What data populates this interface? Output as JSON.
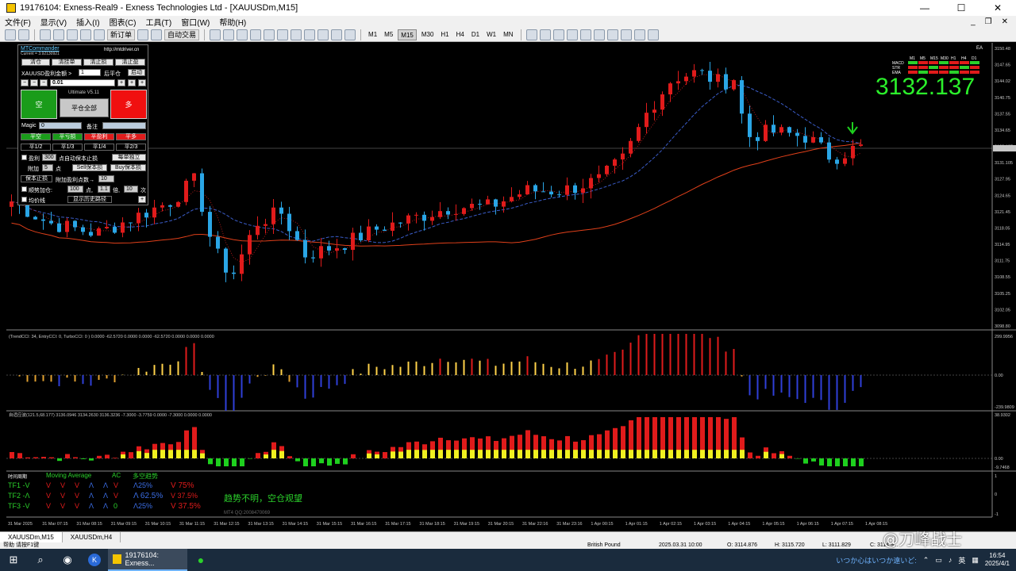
{
  "window": {
    "title": "19176104: Exness-Real9 - Exness Technologies Ltd - [XAUUSDm,M15]",
    "minimize": "—",
    "maximize": "☐",
    "close": "✕"
  },
  "menu": {
    "items": [
      "文件(F)",
      "显示(V)",
      "插入(I)",
      "图表(C)",
      "工具(T)",
      "窗口(W)",
      "帮助(H)"
    ],
    "mdi": [
      "_",
      "❐",
      "✕"
    ]
  },
  "toolbar": {
    "new_order": "新订单",
    "autotrade": "自动交易",
    "timeframes": [
      "M1",
      "M5",
      "M15",
      "M30",
      "H1",
      "H4",
      "D1",
      "W1",
      "MN"
    ],
    "active_timeframe": "M15"
  },
  "price_axis": [
    "3150.48",
    "3147.65",
    "3144.02",
    "3140.75",
    "3137.55",
    "3134.65",
    "3132.137",
    "3131.105",
    "3127.95",
    "3124.65",
    "3121.45",
    "3118.05",
    "3114.95",
    "3111.75",
    "3108.55",
    "3105.25",
    "3102.05",
    "3098.80"
  ],
  "current_price": "3132.137",
  "time_axis": [
    "31 Mar 2025",
    "31 Mar 07:15",
    "31 Mar 08:15",
    "31 Mar 09:15",
    "31 Mar 10:15",
    "31 Mar 11:15",
    "31 Mar 12:15",
    "31 Mar 13:15",
    "31 Mar 14:15",
    "31 Mar 15:15",
    "31 Mar 16:15",
    "31 Mar 17:15",
    "31 Mar 18:15",
    "31 Mar 19:15",
    "31 Mar 20:15",
    "31 Mar 22:16",
    "31 Mar 23:16",
    "1 Apr 00:15",
    "1 Apr 01:15",
    "1 Apr 02:15",
    "1 Apr 03:15",
    "1 Apr 04:15",
    "1 Apr 05:15",
    "1 Apr 06:15",
    "1 Apr 07:15",
    "1 Apr 08:15"
  ],
  "ea_label": "EA",
  "trend_table": {
    "headers": [
      "M1",
      "M5",
      "M15",
      "M30",
      "H1",
      "H4",
      "D1"
    ],
    "rows": [
      "MACD",
      "STR",
      "EMA"
    ],
    "colors": {
      "up": "#2bd12b",
      "down": "#e01b1b"
    }
  },
  "panel": {
    "title": "MTCommander",
    "subtitle": "Current = 3.92130921",
    "url": "http://mtdriver.cn",
    "buttons_row1": [
      "清仓",
      "清挂单",
      "清止损",
      "清止盈"
    ],
    "symbol_label": "XAUUSD盈利金额 >",
    "symbol_value": "1",
    "close_after": "后平仓",
    "start": "启动",
    "lot": "0.01",
    "sell": "空",
    "buy": "多",
    "version": "Ultimate V5.11",
    "close_all": "平仓全部",
    "magic_label": "Magic",
    "magic_value": "0",
    "note_label": "备注",
    "row_close": [
      "平空",
      "平亏损",
      "平盈利",
      "平多"
    ],
    "row_part": [
      "平1/2",
      "平1/3",
      "平1/4",
      "平2/3"
    ],
    "profit_label": "盈利",
    "profit_value": "300",
    "profit_suffix": "点自动保本止损",
    "per_order": "每单独立",
    "add_label": "附加",
    "add_value": "5",
    "add_suffix": "点",
    "sell_be": "Sell保本损",
    "buy_be": "Buy保本损",
    "be_stop": "保本止损",
    "extra_label": "附加盈利点数→",
    "extra_value": "10",
    "trend_add": "顺势加仓:",
    "trend_pts": "100",
    "trend_pts_label": "点,",
    "trend_mult": "1.1",
    "trend_mult_label": "倍,",
    "trend_times": "10",
    "trend_times_label": "次",
    "avg_line": "均价线",
    "show_history": "显示历史路径"
  },
  "indicator1": {
    "label": "(TrendCCI: 34, EntryCCI: 0, TurboCCI: 0 )  0.0000 -62.5720 0.0000 0.0000 -62.5720 0.0000 0.0000 0.0000",
    "max": "299.9956",
    "zero": "0.00",
    "min": "-239.9809"
  },
  "indicator2": {
    "label": "自适应波(121.5,68.177) 3136.0946 3134.2630 3136.3236 -7.3000 -3.7759 0.0000 -7.3000 0.0000 0.0000",
    "max": "38.9302",
    "zero": "0.00",
    "min": "-9.7468"
  },
  "indicator3": {
    "header": [
      "时间周期",
      "Moving Average",
      "AC",
      "多空趋势"
    ],
    "rows": [
      {
        "tf": "TF1 -V",
        "ma": [
          "V",
          "V",
          "V",
          "Λ",
          "Λ"
        ],
        "ac": "V",
        "pct_up": "Λ25%",
        "pct_dn": "V 75%"
      },
      {
        "tf": "TF2 -Λ",
        "ma": [
          "V",
          "V",
          "V",
          "Λ",
          "Λ"
        ],
        "ac": "V",
        "pct_up": "Λ 62.5%",
        "pct_dn": "V 37.5%"
      },
      {
        "tf": "TF3 -V",
        "ma": [
          "V",
          "V",
          "V",
          "Λ",
          "Λ"
        ],
        "ac": "0",
        "pct_up": "Λ25%",
        "pct_dn": "V 37.5%"
      }
    ],
    "verdict": "趋势不明，空仓观望",
    "max": "1",
    "zero": "0",
    "min": "-1",
    "footer": "MT4 QQ:2008470069"
  },
  "tabs": [
    "XAUUSDm,M15",
    "XAUUSDm,H4"
  ],
  "active_tab": "XAUUSDm,M15",
  "status": {
    "help": "帮助 请按F1键",
    "profile": "British Pound",
    "datetime": "2025.03.31 10:00",
    "open": "O: 3114.876",
    "high": "H: 3115.720",
    "low": "L: 3111.829",
    "close": "C: 3114.9..."
  },
  "taskbar": {
    "app_label": "19176104: Exness...",
    "ime_text": "いつか心はいつか遠いど:",
    "lang": "英",
    "time": "16:54",
    "date": "2025/4/1"
  },
  "watermark": "@刀峰战士"
}
